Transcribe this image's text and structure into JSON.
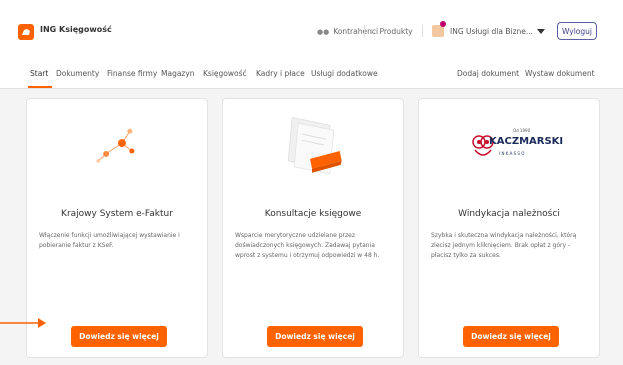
{
  "header": {
    "app_title": "ING Księgowość",
    "links": [
      {
        "label": "Kontrahenci",
        "icon": "people-icon"
      },
      {
        "label": "Produkty",
        "icon": "grid-icon"
      }
    ],
    "company_name": "ING Usługi dla Bizne...",
    "logout_label": "Wyloguj"
  },
  "nav": {
    "items": [
      "Start",
      "Dokumenty",
      "Finanse firmy",
      "Magazyn",
      "Księgowość",
      "Kadry i płace",
      "Usługi dodatkowe"
    ],
    "active": "Start",
    "actions": [
      "Dodaj dokument",
      "Wystaw dokument"
    ]
  },
  "cards": [
    {
      "title": "Krajowy System e-Faktur",
      "description": "Włączenie funkcji umożliwiającej wystawianie i pobieranie faktur z KSeF.",
      "button": "Dowiedz się więcej",
      "illustration": "network-icon"
    },
    {
      "title": "Konsultacje księgowe",
      "description": "Wsparcie merytoryczne udzielane przez doświadczonych księgowych. Zadawaj pytania wprost z systemu i otrzymuj odpowiedzi w 48 h.",
      "button": "Dowiedz się więcej",
      "illustration": "document-icon"
    },
    {
      "title": "Windykacja należności",
      "description": "Szybka i skuteczna windykacja należności, którą zlecisz jednym kliknięciem. Brak opłat z góry - płacisz tylko za sukces.",
      "button": "Dowiedz się więcej",
      "illustration": "kaczmarski-logo",
      "logo_text": "KACZMARSKI",
      "logo_subtext": "I N K A S S O",
      "logo_tagline": "Od 1990"
    }
  ],
  "colors": {
    "accent": "#ff6200",
    "logout_border": "#5a5fa0",
    "logo_red": "#c8102e"
  }
}
